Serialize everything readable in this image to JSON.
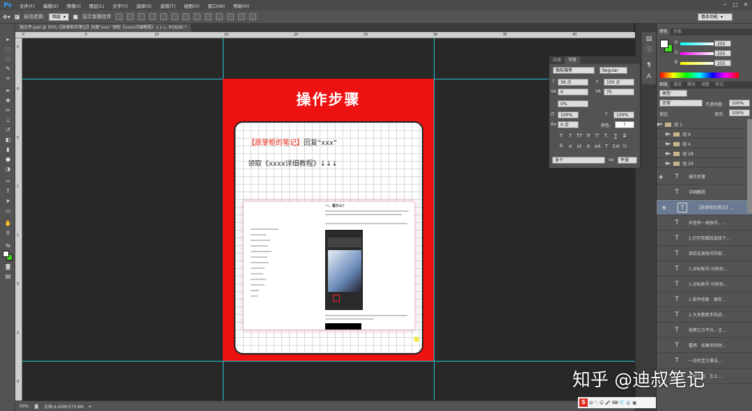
{
  "menu": {
    "logo": "Ps",
    "items": [
      "文件(F)",
      "编辑(E)",
      "图像(I)",
      "图层(L)",
      "文字(Y)",
      "选择(S)",
      "滤镜(T)",
      "视图(V)",
      "窗口(W)",
      "帮助(H)"
    ],
    "win_min": "─",
    "win_max": "□",
    "win_close": "✕"
  },
  "options": {
    "auto_select_label": "自动选择:",
    "auto_select_value": "图层",
    "show_transform_label": "显示变换控件",
    "workspace": "基本功能"
  },
  "doc_tab": "源文件.psd @ 50% (【辰掌柜的笔记】回复\"xxx\" 领取《xxxx详细教程》↓↓↓, RGB/8) *",
  "ruler": {
    "top": [
      "0",
      "5",
      "10",
      "15",
      "20",
      "25",
      "30",
      "35",
      "40"
    ],
    "left": [
      "5",
      "0",
      "5",
      "1",
      "1",
      "5",
      "2",
      "0"
    ]
  },
  "artboard": {
    "title": "操作步骤",
    "line1_red": "【辰掌柜的笔记】",
    "line1_rest": "回复“xxx”",
    "line2": "领取《xxxx详细教程》↓↓↓",
    "shot_heading": "一、看什么？"
  },
  "status": {
    "zoom": "50%",
    "doc": "文档:4.45M/373.6M"
  },
  "char_panel": {
    "tabs": [
      "段落",
      "字符"
    ],
    "font": "微软雅黑",
    "style": "Regular",
    "size": "36 点",
    "leading": "100 点",
    "kerning": "0",
    "tracking": "75",
    "scale_pct": "0%",
    "vscale": "100%",
    "hscale": "100%",
    "baseline": "0 点",
    "color_label": "颜色:",
    "color_value": "?",
    "style_buttons": [
      "T",
      "T",
      "TT",
      "Tr",
      "T'",
      "T,",
      "T",
      "T"
    ],
    "opentype_buttons": [
      "fi",
      "ơ",
      "st",
      "A",
      "ad",
      "T",
      "1st",
      "½"
    ],
    "lang": "多个",
    "aa_label": "aa",
    "aa": "平滑"
  },
  "color_panel": {
    "tabs": [
      "颜色",
      "色板"
    ],
    "r_label": "R",
    "r": "255",
    "g_label": "G",
    "g": "255",
    "b_label": "B",
    "b": "255"
  },
  "layers_panel": {
    "tabs": [
      "图层",
      "通道",
      "路径",
      "调整",
      "样式"
    ],
    "filter": "类型",
    "blend": "正常",
    "opacity_label": "不透明度:",
    "opacity": "100%",
    "lock_label": "锁定:",
    "fill_label": "填充:",
    "fill": "100%",
    "groups": [
      "组 1",
      "组 6",
      "组 4",
      "组 28",
      "组 29"
    ],
    "layers": [
      "操作步骤",
      "详细教程",
      "【辰掌柜的笔记】...",
      "抖音有一类账号，...",
      "1.打开剪辑后选择下...",
      "目前这类账号的现...",
      "1.对标账号-分析别...",
      "1.对标账号-分析别...",
      "1.软件修复　保存...",
      "1.大多数新手的迹...",
      "找第三方平台，注...",
      "看两　如果你同时...",
      "一日利宝方撕法...",
      "素材下载　左上..."
    ]
  },
  "watermark": "知乎 @迪叔笔记",
  "taskbar": {
    "ime": "S",
    "items": [
      "中",
      "°,",
      "☺",
      "🎤",
      "⌨",
      "👕",
      "👔",
      "▦"
    ]
  },
  "colors": {
    "ps_bg": "#282828",
    "panel": "#535353",
    "artboard_red": "#ee1111",
    "guide": "#27c8d6",
    "accent_red": "#e21111"
  }
}
